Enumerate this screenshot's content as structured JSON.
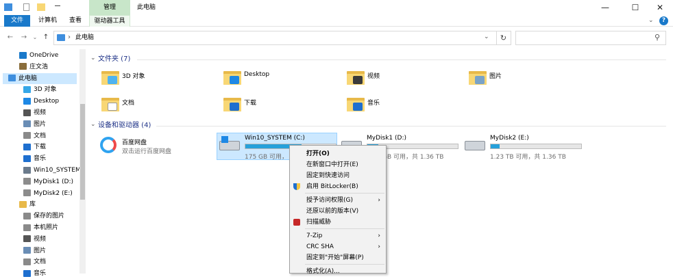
{
  "window": {
    "manage_tab": "管理",
    "title": "此电脑",
    "controls": {
      "minimize": "—",
      "maximize": "☐",
      "close": "✕"
    }
  },
  "ribbon": {
    "tabs": [
      "文件",
      "计算机",
      "查看"
    ],
    "context_tab": "驱动器工具",
    "help": "?"
  },
  "nav": {
    "back": "←",
    "forward": "→",
    "recent": "⌄",
    "up": "↑",
    "path": "此电脑",
    "path_sep": "›",
    "addr_dropdown": "⌄",
    "refresh": "↻",
    "search_icon": "⚲"
  },
  "sidebar": {
    "items": [
      {
        "label": "OneDrive",
        "icon": "cloud-icon",
        "color": "#1979ca"
      },
      {
        "label": "庄文浩",
        "icon": "user-icon",
        "color": "#8a6d3b"
      },
      {
        "label": "此电脑",
        "icon": "computer-icon",
        "color": "#3e8ede",
        "selected": true
      },
      {
        "label": "3D 对象",
        "icon": "cube-icon",
        "color": "#35a7e8"
      },
      {
        "label": "Desktop",
        "icon": "desktop-icon",
        "color": "#1e88e5"
      },
      {
        "label": "视频",
        "icon": "video-icon",
        "color": "#555555"
      },
      {
        "label": "图片",
        "icon": "picture-icon",
        "color": "#6a8db5"
      },
      {
        "label": "文档",
        "icon": "document-icon",
        "color": "#8a8a8a"
      },
      {
        "label": "下载",
        "icon": "download-icon",
        "color": "#1e6fcf"
      },
      {
        "label": "音乐",
        "icon": "music-icon",
        "color": "#1e6fcf"
      },
      {
        "label": "Win10_SYSTEM",
        "icon": "drive-icon",
        "color": "#6b7b8c"
      },
      {
        "label": "MyDisk1 (D:)",
        "icon": "drive-icon",
        "color": "#8c8c8c"
      },
      {
        "label": "MyDisk2 (E:)",
        "icon": "drive-icon",
        "color": "#8c8c8c"
      },
      {
        "label": "库",
        "icon": "library-icon",
        "color": "#e8b949"
      },
      {
        "label": "保存的图片",
        "icon": "library-picture-icon",
        "color": "#8a8a8a"
      },
      {
        "label": "本机照片",
        "icon": "library-picture-icon",
        "color": "#8a8a8a"
      },
      {
        "label": "视频",
        "icon": "library-video-icon",
        "color": "#555555"
      },
      {
        "label": "图片",
        "icon": "library-picture-icon",
        "color": "#6a8db5"
      },
      {
        "label": "文档",
        "icon": "library-document-icon",
        "color": "#8a8a8a"
      },
      {
        "label": "音乐",
        "icon": "library-music-icon",
        "color": "#1e6fcf"
      }
    ]
  },
  "folders": {
    "header": "文件夹 (7)",
    "items": [
      {
        "name": "3D 对象",
        "badge": "#4fb3f0"
      },
      {
        "name": "Desktop",
        "badge": "#1e88e5"
      },
      {
        "name": "视频",
        "badge": "#3a3a3a"
      },
      {
        "name": "图片",
        "badge": "#7aa3c8"
      },
      {
        "name": "文档",
        "badge": "#ffffff"
      },
      {
        "name": "下载",
        "badge": "#1e6fcf"
      },
      {
        "name": "音乐",
        "badge": "#1e6fcf"
      }
    ]
  },
  "devices": {
    "header": "设备和驱动器 (4)",
    "baidu": {
      "name": "百度网盘",
      "sub": "双击运行百度网盘"
    },
    "drives": [
      {
        "name": "Win10_SYSTEM (C:)",
        "free": "175 GB 可用，",
        "fill": 0.62
      },
      {
        "name": "MyDisk1 (D:)",
        "free": "GB 可用，共 1.36 TB",
        "fill": 0.12
      },
      {
        "name": "MyDisk2 (E:)",
        "free": "1.23 TB 可用，共 1.36 TB",
        "fill": 0.1
      }
    ]
  },
  "context_menu": {
    "items": [
      {
        "label": "打开(O)",
        "bold": true
      },
      {
        "label": "在新窗口中打开(E)"
      },
      {
        "label": "固定到快速访问"
      },
      {
        "label": "启用 BitLocker(B)",
        "icon": "bitlocker-shield-icon"
      },
      {
        "label": "授予访问权限(G)",
        "arrow": "›"
      },
      {
        "label": "还原以前的版本(V)"
      },
      {
        "label": "扫描威胁",
        "icon": "antivirus-icon"
      },
      {
        "label": "7-Zip",
        "arrow": "›"
      },
      {
        "label": "CRC SHA",
        "arrow": "›"
      },
      {
        "label": "固定到\"开始\"屏幕(P)"
      },
      {
        "label": "格式化(A)..."
      }
    ]
  }
}
